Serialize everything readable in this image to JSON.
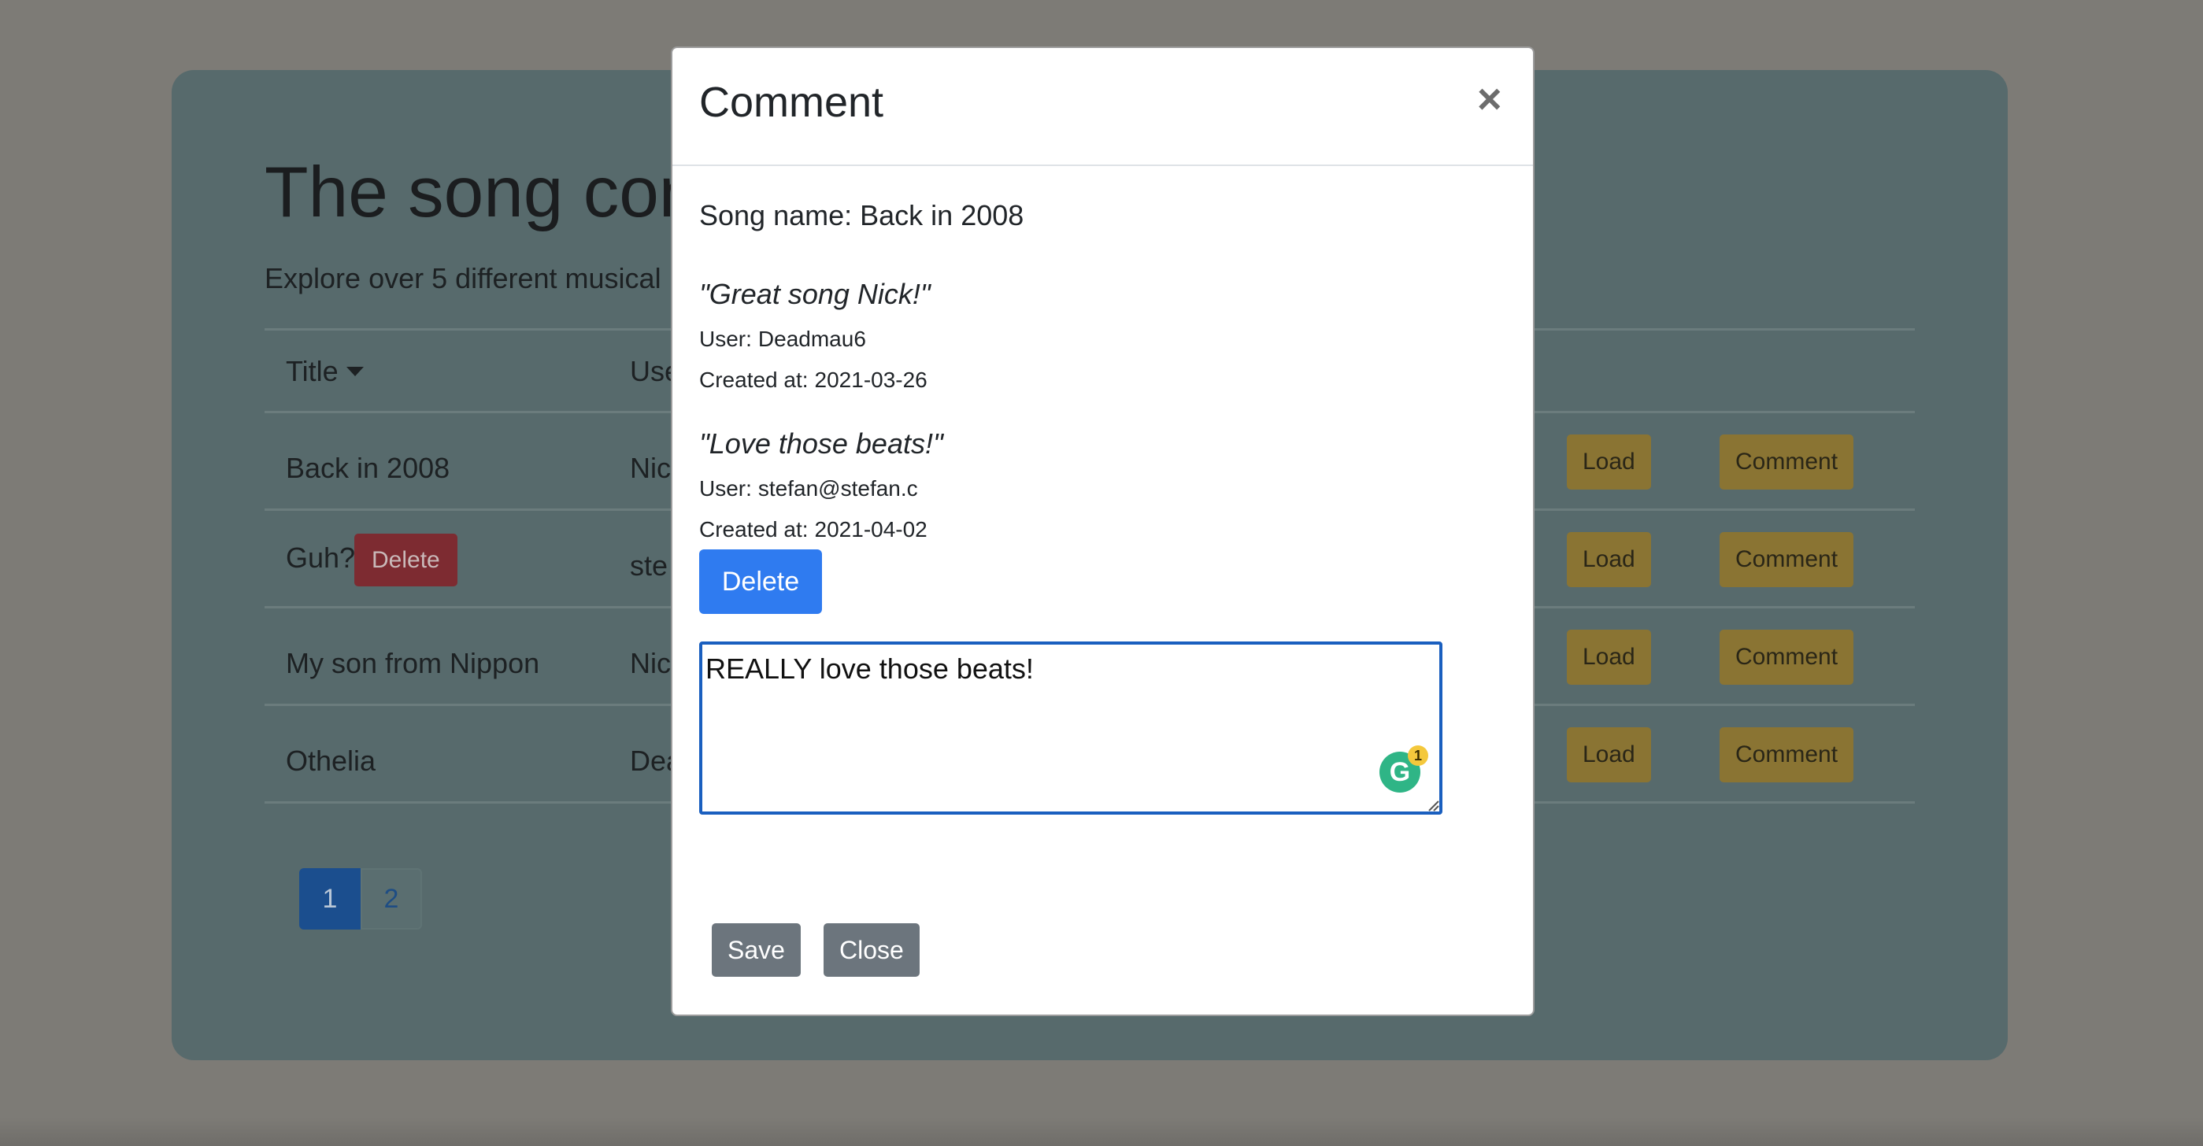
{
  "page": {
    "title": "The song con",
    "lead": "Explore over 5 different musical i",
    "table": {
      "headers": {
        "title": "Title",
        "user": "Use"
      },
      "rows": [
        {
          "title": "Back in 2008",
          "user": "Nic",
          "load": "Load",
          "comment": "Comment"
        },
        {
          "title": "Guh?",
          "user": "ste",
          "delete": "Delete",
          "load": "Load",
          "comment": "Comment"
        },
        {
          "title": "My son from Nippon",
          "user": "Nic",
          "load": "Load",
          "comment": "Comment"
        },
        {
          "title": "Othelia",
          "user": "Dea",
          "load": "Load",
          "comment": "Comment"
        }
      ]
    },
    "pagination": {
      "pages": [
        "1",
        "2"
      ],
      "active": "1"
    }
  },
  "modal": {
    "title": "Comment",
    "close_symbol": "×",
    "song_label": "Song name:",
    "song_name": "Back in 2008",
    "comments": [
      {
        "text": "\"Great song Nick!\"",
        "user_label": "User:",
        "user": "Deadmau6",
        "created_label": "Created at:",
        "created": "2021-03-26"
      },
      {
        "text": "\"Love those beats!\"",
        "user_label": "User:",
        "user": "stefan@stefan.c",
        "created_label": "Created at:",
        "created": "2021-04-02"
      }
    ],
    "delete_label": "Delete",
    "textarea_value": "REALLY love those beats!",
    "grammarly": {
      "letter": "G",
      "count": "1"
    },
    "save_label": "Save",
    "close_label": "Close"
  },
  "colors": {
    "overlay": "#7d7b76",
    "jumbotron": "#576a6c",
    "primary": "#2f7bf0",
    "secondary": "#6c757d",
    "warning_dimmed": "#8a7433",
    "danger_dimmed": "#7d2b31"
  },
  "icons": [
    "close-icon",
    "caret-down-icon",
    "grammarly-icon",
    "resize-grip-icon"
  ]
}
